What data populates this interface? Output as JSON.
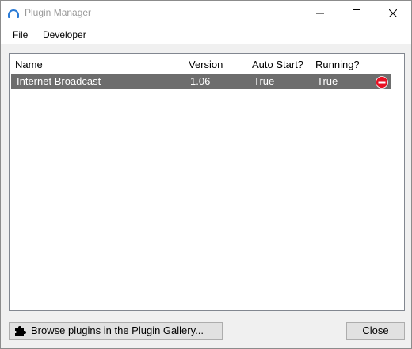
{
  "window": {
    "title": "Plugin Manager",
    "app_icon": "headphones-icon",
    "controls": {
      "minimize": "minimize-icon",
      "maximize": "maximize-icon",
      "close": "close-icon"
    }
  },
  "menu": {
    "file": "File",
    "developer": "Developer"
  },
  "list": {
    "headers": {
      "name": "Name",
      "version": "Version",
      "auto_start": "Auto Start?",
      "running": "Running?"
    },
    "rows": [
      {
        "name": "Internet Broadcast",
        "version": "1.06",
        "auto_start": "True",
        "running": "True",
        "action_icon": "remove-icon"
      }
    ]
  },
  "buttons": {
    "browse": "Browse plugins in the Plugin Gallery...",
    "close": "Close"
  },
  "colors": {
    "selected_row": "#6d6d6d",
    "remove_icon": "#e81123",
    "title_icon": "#2b7bd6"
  }
}
